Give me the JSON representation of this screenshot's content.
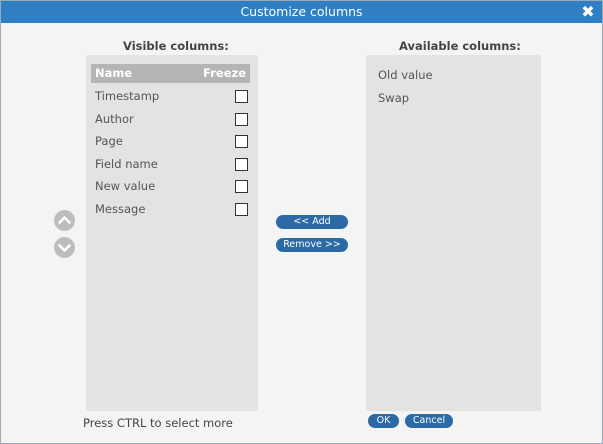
{
  "dialog": {
    "title": "Customize columns",
    "close_glyph": "✖"
  },
  "visible_columns": {
    "heading": "Visible columns:",
    "header_name": "Name",
    "header_freeze": "Freeze",
    "items": [
      {
        "label": "Timestamp",
        "frozen": false
      },
      {
        "label": "Author",
        "frozen": false
      },
      {
        "label": "Page",
        "frozen": false
      },
      {
        "label": "Field name",
        "frozen": false
      },
      {
        "label": "New value",
        "frozen": false
      },
      {
        "label": "Message",
        "frozen": false
      }
    ]
  },
  "available_columns": {
    "heading": "Available columns:",
    "items": [
      {
        "label": "Old value"
      },
      {
        "label": "Swap"
      }
    ]
  },
  "buttons": {
    "add": "<< Add",
    "remove": "Remove >>",
    "ok": "OK",
    "cancel": "Cancel"
  },
  "hint": "Press CTRL to select more",
  "icons": {
    "move_up": "chevron-up-icon",
    "move_down": "chevron-down-icon",
    "close": "close-icon"
  },
  "colors": {
    "titlebar": "#2f7fc4",
    "button": "#2c6aa6",
    "panel": "#e3e3e3"
  }
}
